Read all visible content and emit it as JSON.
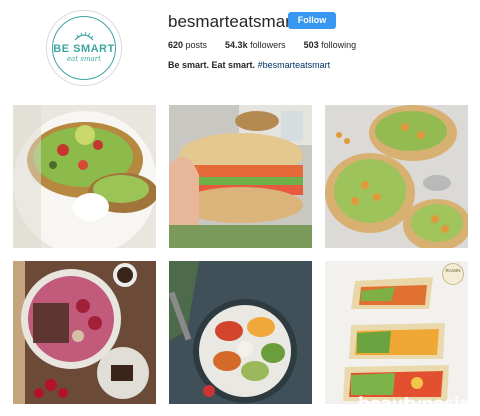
{
  "profile": {
    "username": "besmarteatsmart",
    "follow_label": "Follow",
    "posts_count": "620",
    "posts_label": " posts",
    "followers_count": "54.3k",
    "followers_label": " followers",
    "following_count": "503",
    "following_label": " following",
    "bio_text": "Be smart. Eat smart.",
    "bio_hashtag": "#besmarteatsmart"
  },
  "logo": {
    "main": "BE SMART",
    "sub": "eat smart"
  },
  "accent_colors": {
    "follow": "#3897f0",
    "logo": "#3fa7a0"
  },
  "posts": [
    {
      "icon": "avocado-toast-image"
    },
    {
      "icon": "sandwich-image"
    },
    {
      "icon": "chickpea-flatbread-image"
    },
    {
      "icon": "smoothie-bowl-image"
    },
    {
      "icon": "buddha-bowl-image"
    },
    {
      "icon": "veggie-wraps-image"
    }
  ],
  "badge_text": "RAISIN",
  "watermark": "beautynesia"
}
